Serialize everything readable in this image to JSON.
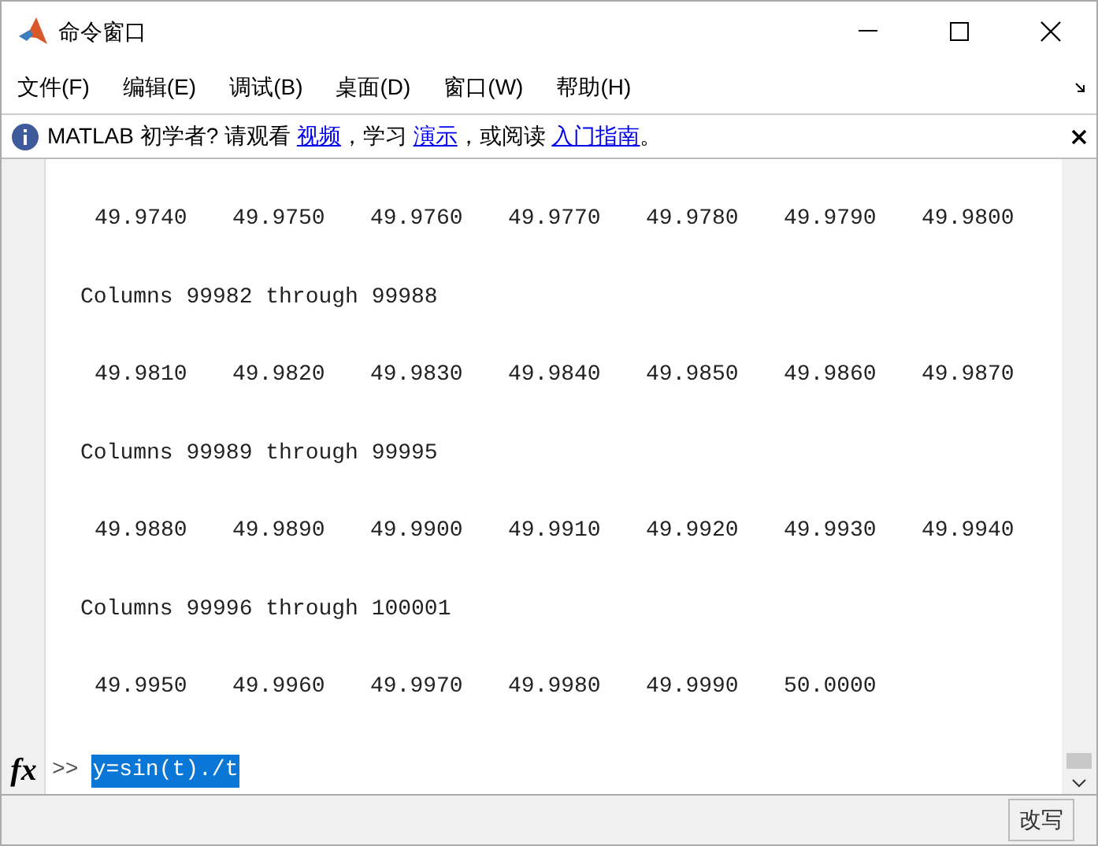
{
  "window": {
    "title": "命令窗口"
  },
  "menu": [
    {
      "label": "文件(F)"
    },
    {
      "label": "编辑(E)"
    },
    {
      "label": "调试(B)"
    },
    {
      "label": "桌面(D)"
    },
    {
      "label": "窗口(W)"
    },
    {
      "label": "帮助(H)"
    }
  ],
  "info_bar": {
    "text": "MATLAB 初学者? 请观看",
    "link_1": "视频",
    "text_2": "，学习",
    "link_2": "演示",
    "text_3": "，或阅读",
    "link_3": "入门指南",
    "text_4": "。"
  },
  "output": [
    {
      "kind": "values",
      "values": [
        "49.9740",
        "49.9750",
        "49.9760",
        "49.9770",
        "49.9780",
        "49.9790",
        "49.9800"
      ]
    },
    {
      "kind": "header",
      "text": "Columns 99982 through 99988"
    },
    {
      "kind": "values",
      "values": [
        "49.9810",
        "49.9820",
        "49.9830",
        "49.9840",
        "49.9850",
        "49.9860",
        "49.9870"
      ]
    },
    {
      "kind": "header",
      "text": "Columns 99989 through 99995"
    },
    {
      "kind": "values",
      "values": [
        "49.9880",
        "49.9890",
        "49.9900",
        "49.9910",
        "49.9920",
        "49.9930",
        "49.9940"
      ]
    },
    {
      "kind": "header",
      "text": "Columns 99996 through 100001"
    },
    {
      "kind": "values",
      "values": [
        "49.9950",
        "49.9960",
        "49.9970",
        "49.9980",
        "49.9990",
        "50.0000"
      ]
    }
  ],
  "command_line": {
    "function_icon": "fx",
    "prompt": ">>",
    "value": "y=sin(t)./t",
    "selected": true
  },
  "status_bar": {
    "mode": "改写"
  }
}
